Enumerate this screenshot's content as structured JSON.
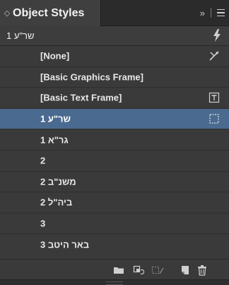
{
  "panel": {
    "tab_title": "Object Styles",
    "tab_grip": "◇",
    "collapse_glyph": "»"
  },
  "current_style": "שר\"ע 1",
  "styles": [
    {
      "label": "[None]",
      "icon": "no-style-icon",
      "selected": false
    },
    {
      "label": "[Basic Graphics Frame]",
      "icon": "",
      "selected": false
    },
    {
      "label": "[Basic Text Frame]",
      "icon": "text-frame-icon",
      "selected": false
    },
    {
      "label": "שר\"ע 1",
      "icon": "graphics-frame-icon",
      "selected": true
    },
    {
      "label": "גר\"א 1",
      "icon": "",
      "selected": false
    },
    {
      "label": "2",
      "icon": "",
      "selected": false
    },
    {
      "label": "משנ\"ב 2",
      "icon": "",
      "selected": false
    },
    {
      "label": "ביה\"ל 2",
      "icon": "",
      "selected": false
    },
    {
      "label": "3",
      "icon": "",
      "selected": false
    },
    {
      "label": "באר היטב 3",
      "icon": "",
      "selected": false
    }
  ],
  "colors": {
    "selected_row": "#4a6a8f",
    "panel_bg": "#3a3a3a"
  }
}
